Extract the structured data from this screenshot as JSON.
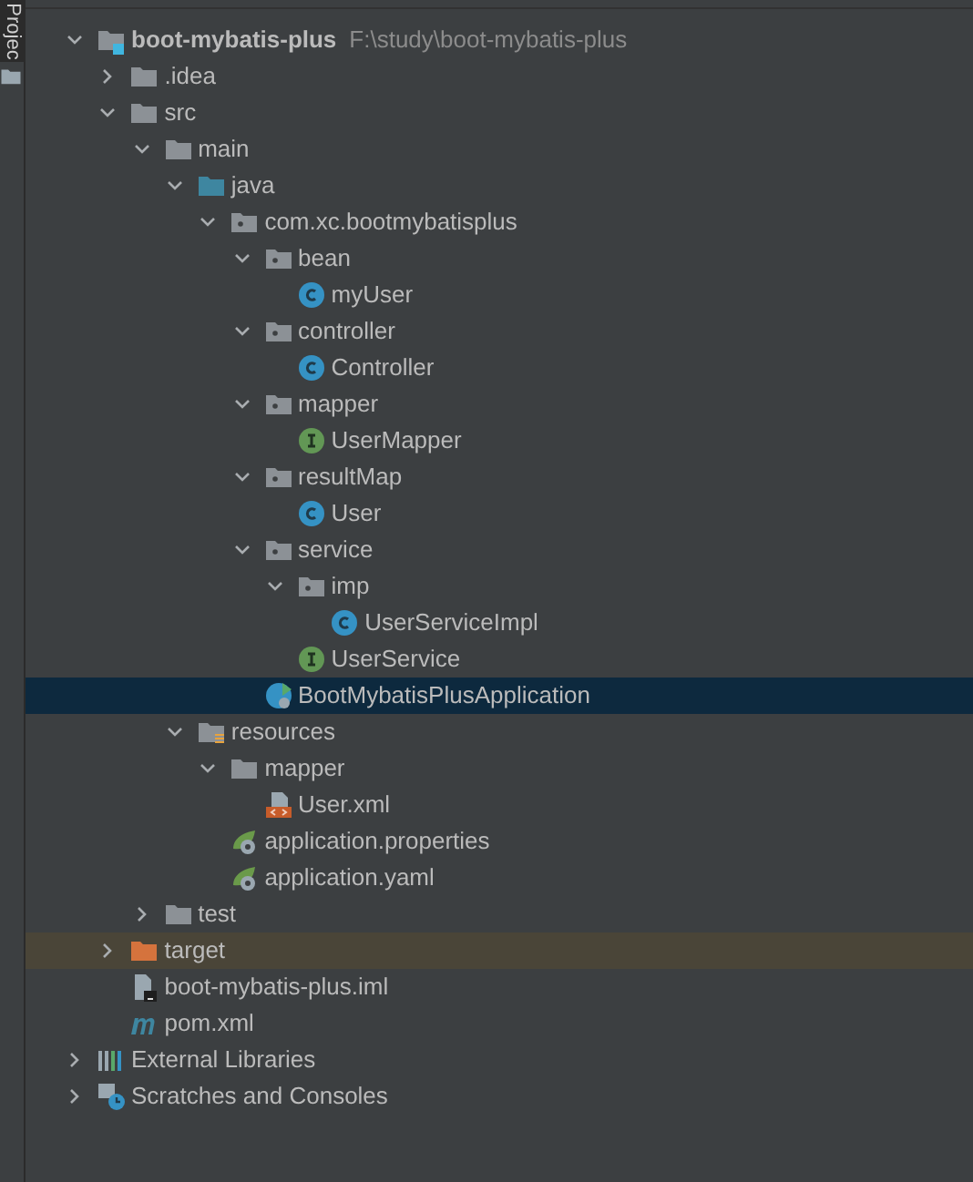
{
  "side_tab": {
    "label": "Projec",
    "selected": true
  },
  "tree": [
    {
      "label": "boot-mybatis-plus",
      "path": "F:\\study\\boot-mybatis-plus",
      "kind": "module",
      "expanded": true,
      "selected": false,
      "children": [
        {
          "label": ".idea",
          "kind": "folder",
          "expanded": false,
          "selected": false
        },
        {
          "label": "src",
          "kind": "folder",
          "expanded": true,
          "selected": false,
          "children": [
            {
              "label": "main",
              "kind": "folder",
              "expanded": true,
              "selected": false,
              "children": [
                {
                  "label": "java",
                  "kind": "source",
                  "expanded": true,
                  "selected": false,
                  "children": [
                    {
                      "label": "com.xc.bootmybatisplus",
                      "kind": "package",
                      "expanded": true,
                      "selected": false,
                      "children": [
                        {
                          "label": "bean",
                          "kind": "package",
                          "expanded": true,
                          "selected": false,
                          "children": [
                            {
                              "label": "myUser",
                              "kind": "class",
                              "selected": false
                            }
                          ]
                        },
                        {
                          "label": "controller",
                          "kind": "package",
                          "expanded": true,
                          "selected": false,
                          "children": [
                            {
                              "label": "Controller",
                              "kind": "class",
                              "selected": false
                            }
                          ]
                        },
                        {
                          "label": "mapper",
                          "kind": "package",
                          "expanded": true,
                          "selected": false,
                          "children": [
                            {
                              "label": "UserMapper",
                              "kind": "interface",
                              "selected": false
                            }
                          ]
                        },
                        {
                          "label": "resultMap",
                          "kind": "package",
                          "expanded": true,
                          "selected": false,
                          "children": [
                            {
                              "label": "User",
                              "kind": "class",
                              "selected": false
                            }
                          ]
                        },
                        {
                          "label": "service",
                          "kind": "package",
                          "expanded": true,
                          "selected": false,
                          "children": [
                            {
                              "label": "imp",
                              "kind": "package",
                              "expanded": true,
                              "selected": false,
                              "children": [
                                {
                                  "label": "UserServiceImpl",
                                  "kind": "class",
                                  "selected": false
                                }
                              ]
                            },
                            {
                              "label": "UserService",
                              "kind": "interface",
                              "selected": false
                            }
                          ]
                        },
                        {
                          "label": "BootMybatisPlusApplication",
                          "kind": "application",
                          "selected": true
                        }
                      ]
                    }
                  ]
                },
                {
                  "label": "resources",
                  "kind": "resources",
                  "expanded": true,
                  "selected": false,
                  "children": [
                    {
                      "label": "mapper",
                      "kind": "folder",
                      "expanded": true,
                      "selected": false,
                      "children": [
                        {
                          "label": "User.xml",
                          "kind": "xml",
                          "selected": false
                        }
                      ]
                    },
                    {
                      "label": "application.properties",
                      "kind": "config",
                      "selected": false
                    },
                    {
                      "label": "application.yaml",
                      "kind": "config",
                      "selected": false
                    }
                  ]
                }
              ]
            },
            {
              "label": "test",
              "kind": "folder",
              "expanded": false,
              "selected": false
            }
          ]
        },
        {
          "label": "target",
          "kind": "excluded",
          "expanded": false,
          "selected": false
        },
        {
          "label": "boot-mybatis-plus.iml",
          "kind": "iml",
          "selected": false
        },
        {
          "label": "pom.xml",
          "kind": "maven",
          "selected": false
        }
      ]
    },
    {
      "label": "External Libraries",
      "kind": "libraries",
      "expanded": false,
      "selected": false
    },
    {
      "label": "Scratches and Consoles",
      "kind": "scratches",
      "expanded": false,
      "selected": false
    }
  ]
}
